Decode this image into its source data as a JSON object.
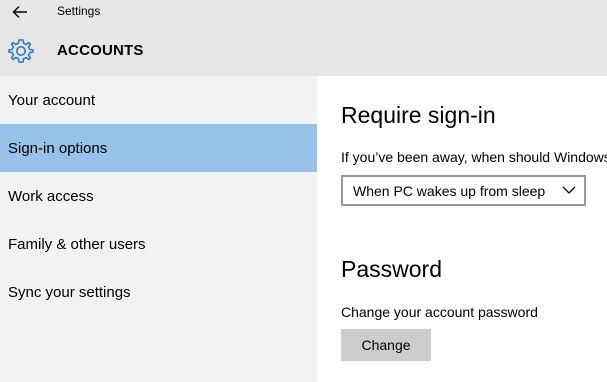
{
  "window": {
    "title": "Settings",
    "back_icon": "back-arrow-icon"
  },
  "header": {
    "icon": "gear-icon",
    "title": "ACCOUNTS"
  },
  "sidebar": {
    "items": [
      {
        "label": "Your account",
        "selected": false
      },
      {
        "label": "Sign-in options",
        "selected": true
      },
      {
        "label": "Work access",
        "selected": false
      },
      {
        "label": "Family & other users",
        "selected": false
      },
      {
        "label": "Sync your settings",
        "selected": false
      }
    ]
  },
  "main": {
    "require_signin": {
      "heading": "Require sign-in",
      "question": "If you’ve been away, when should Windows require you to sign in again?",
      "dropdown_value": "When PC wakes up from sleep"
    },
    "password": {
      "heading": "Password",
      "description": "Change your account password",
      "button_label": "Change"
    }
  },
  "colors": {
    "header_bg": "#e6e6e6",
    "sidebar_bg": "#f2f2f2",
    "selected_bg": "#98c2ea",
    "accent": "#2d7cc7",
    "button_bg": "#cccccc"
  }
}
